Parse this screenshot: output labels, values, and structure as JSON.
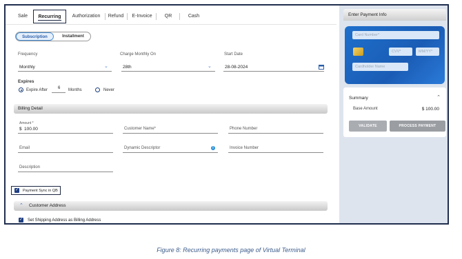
{
  "tabs": [
    {
      "label": "Sale"
    },
    {
      "label": "Recurring"
    },
    {
      "label": "Authorization"
    },
    {
      "label": "Refund"
    },
    {
      "label": "E-Invoice"
    },
    {
      "label": "QR"
    },
    {
      "label": "Cash"
    }
  ],
  "mode_toggle": {
    "subscription": "Subscription",
    "installment": "Installment"
  },
  "frequency": {
    "label": "Frequency",
    "value": "Monthly"
  },
  "charge_monthly_on": {
    "label": "Charge Monthly On",
    "value": "28th"
  },
  "start_date": {
    "label": "Start Date",
    "value": "28-08-2024"
  },
  "expires": {
    "label": "Expires",
    "expire_after": "Expire After",
    "count": "6",
    "months": "Months",
    "never": "Never"
  },
  "billing_detail": {
    "title": "Billing Detail",
    "amount_label": "Amount *",
    "currency": "$",
    "amount_value": "100.00",
    "customer_name": "Customer Name*",
    "phone_number": "Phone Number",
    "email": "Email",
    "dynamic_descriptor": "Dynamic Descriptor",
    "invoice_number": "Invoice Number",
    "description": "Description"
  },
  "payment_sync": "Payment Sync in QB",
  "customer_address": {
    "title": "Customer Address",
    "same_as_billing": "Set Shipping Address as Billing Address"
  },
  "payment_info": {
    "title": "Enter Payment Info",
    "card_number": "Card Number*",
    "cvv": "CVV*",
    "expiry": "MM/YY*",
    "cardholder": "Cardholder Name"
  },
  "summary": {
    "title": "Summary",
    "base_amount_label": "Base Amount",
    "base_amount_value": "$ 100.00",
    "validate": "VALIDATE",
    "process_payment": "PROCESS PAYMENT"
  },
  "caption": "Figure 8: Recurring payments page of Virtual Terminal",
  "colors": {
    "accent": "#1f3f82",
    "frame": "#1f2d4d",
    "card": "#1a5cb5",
    "side_bg": "#dde4ee"
  }
}
